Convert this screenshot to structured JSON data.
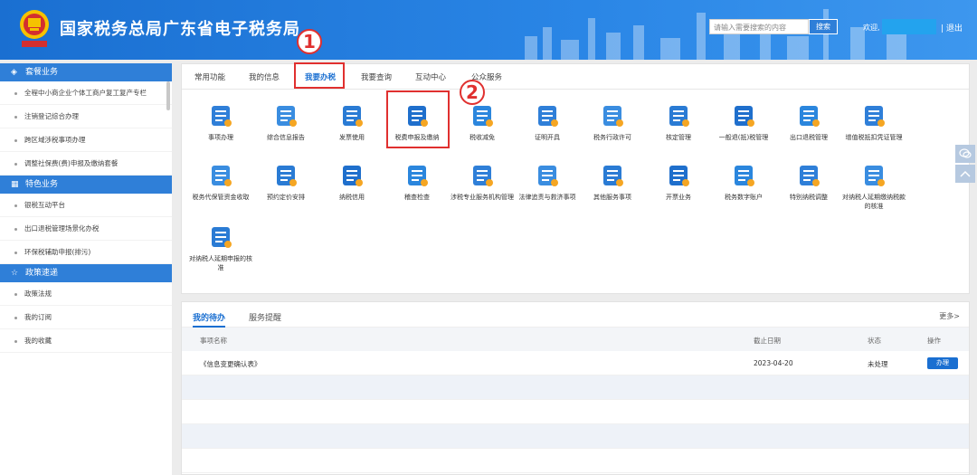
{
  "header": {
    "site_title": "国家税务总局广东省电子税务局",
    "search_placeholder": "请输入需要搜索的内容",
    "search_button": "搜索",
    "welcome": "欢迎,",
    "logout": "| 退出"
  },
  "sidebar": {
    "sections": [
      {
        "title": "套餐业务",
        "icon": "layers-icon",
        "items": [
          "全程中小商企业个体工商户复工复产专栏",
          "注销登记综合办理",
          "跨区域涉税事项办理",
          "调整社保费(费)申报及缴纳套餐"
        ]
      },
      {
        "title": "特色业务",
        "icon": "grid-icon",
        "items": [
          "银税互动平台",
          "出口退税管理场景化办税",
          "环保税辅助申报(排污)"
        ]
      },
      {
        "title": "政策速递",
        "icon": "star-icon",
        "items": [
          "政策法规",
          "我的订阅",
          "我的收藏"
        ]
      }
    ]
  },
  "main": {
    "tabs": [
      "常用功能",
      "我的信息",
      "我要办税",
      "我要查询",
      "互动中心",
      "公众服务"
    ],
    "active_tab": "我要办税",
    "services": [
      {
        "label": "事项办理",
        "icon": "pen-icon"
      },
      {
        "label": "综合信息报告",
        "icon": "document-icon"
      },
      {
        "label": "发票使用",
        "icon": "invoice-icon"
      },
      {
        "label": "税费申报及缴纳",
        "icon": "tax-declare-icon"
      },
      {
        "label": "税收减免",
        "icon": "coins-icon"
      },
      {
        "label": "证明开具",
        "icon": "certificate-icon"
      },
      {
        "label": "税务行政许可",
        "icon": "license-icon"
      },
      {
        "label": "核定管理",
        "icon": "user-gear-icon"
      },
      {
        "label": "一般退(抵)税管理",
        "icon": "refund-icon"
      },
      {
        "label": "出口退税管理",
        "icon": "export-refund-icon"
      },
      {
        "label": "增值税抵扣凭证管理",
        "icon": "voucher-icon"
      },
      {
        "label": "税务代保管资金收取",
        "icon": "money-bag-icon"
      },
      {
        "label": "预约定价安排",
        "icon": "appointment-icon"
      },
      {
        "label": "纳税信用",
        "icon": "credit-icon"
      },
      {
        "label": "稽查检查",
        "icon": "inspect-icon"
      },
      {
        "label": "涉税专业服务机构管理",
        "icon": "agency-icon"
      },
      {
        "label": "法律追责与救济事项",
        "icon": "gavel-icon"
      },
      {
        "label": "其他服务事项",
        "icon": "other-services-icon"
      },
      {
        "label": "开票业务",
        "icon": "invoicing-icon"
      },
      {
        "label": "税务数字账户",
        "icon": "digital-account-icon"
      },
      {
        "label": "特别纳税调整",
        "icon": "adjust-icon"
      },
      {
        "label": "对纳税人延期缴纳税款的核准",
        "icon": "deferral-icon"
      },
      {
        "label": "对纳税人延期申报的核准",
        "icon": "deferral-declare-icon"
      }
    ]
  },
  "annotations": {
    "step1": "1",
    "step2": "2"
  },
  "todo": {
    "tabs": [
      "我的待办",
      "服务提醒"
    ],
    "more": "更多>",
    "columns": [
      "事项名称",
      "截止日期",
      "状态",
      "操作"
    ],
    "rows": [
      {
        "name": "《信息变更确认表》",
        "deadline": "2023-04-20",
        "status": "未处理",
        "action": "办理"
      }
    ]
  },
  "colors": {
    "accent": "#1a6fd1",
    "highlight": "#e0302f"
  }
}
